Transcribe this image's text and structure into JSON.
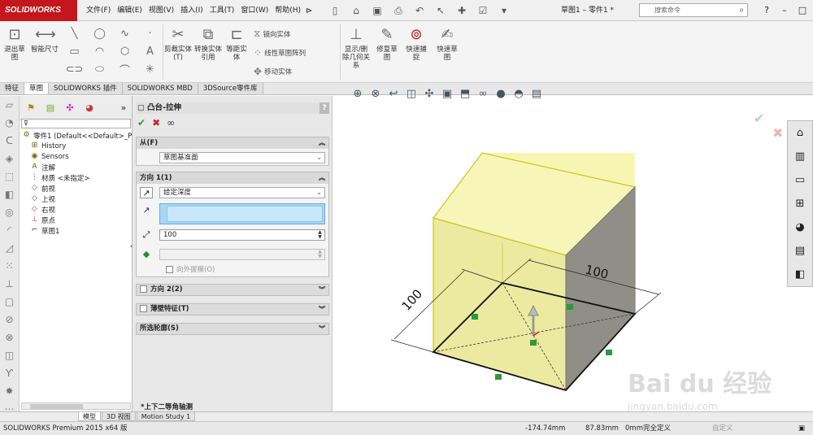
{
  "app": {
    "brand": "SOLIDWORKS",
    "title": "草图1 – 零件1 *",
    "search_placeholder": "搜索命令"
  },
  "menu": [
    "文件(F)",
    "编辑(E)",
    "视图(V)",
    "插入(I)",
    "工具(T)",
    "窗口(W)",
    "帮助(H)"
  ],
  "ribbon": {
    "exit_sketch": "退出草图",
    "smart_dim": "智能尺寸",
    "trim": "剪裁实体(T)",
    "convert": "转换实体引用",
    "offset": "等距实体",
    "mirror": "镜向实体",
    "linear_pattern": "线性草图阵列",
    "move": "移动实体",
    "display_delete": "显示/删除几何关系",
    "repair": "修复草图",
    "quick_snap": "快速捕捉",
    "rapid_sketch": "快速草图"
  },
  "command_tabs": [
    "特征",
    "草图",
    "SOLIDWORKS 插件",
    "SOLIDWORKS MBD",
    "3DSource零件库"
  ],
  "tree": {
    "root": "零件1  (Default<<Default>_P",
    "items": [
      "History",
      "Sensors",
      "注解",
      "材质 <未指定>",
      "前视",
      "上视",
      "右视",
      "原点",
      "草图1"
    ]
  },
  "property_manager": {
    "title": "凸台-拉伸",
    "from_label": "从(F)",
    "from_value": "草图基准面",
    "dir1_label": "方向 1(1)",
    "end_condition": "给定深度",
    "depth_value": "100",
    "draft_outward": "向外拔模(O)",
    "dir2_label": "方向 2(2)",
    "thin_label": "薄壁特征(T)",
    "contours_label": "所选轮廓(S)"
  },
  "graphics": {
    "view_name": "*上下二等角轴测",
    "dim_a": "100",
    "dim_b": "100"
  },
  "bottom_tabs": [
    "模型",
    "3D 视图",
    "Motion Study 1"
  ],
  "status": {
    "product": "SOLIDWORKS Premium 2015 x64 版",
    "x": "-174.74mm",
    "y": "87.83mm",
    "z": "0mm",
    "state": "完全定义",
    "mode": "自定义"
  },
  "colors": {
    "brand_red": "#c4161c",
    "preview_fill": "#f5f3a3",
    "preview_edge": "#c8c820",
    "selection_blue": "#a9d6f5"
  },
  "watermark": {
    "line1": "Bai du 经验",
    "line2": "jingyan.baidu.com"
  }
}
